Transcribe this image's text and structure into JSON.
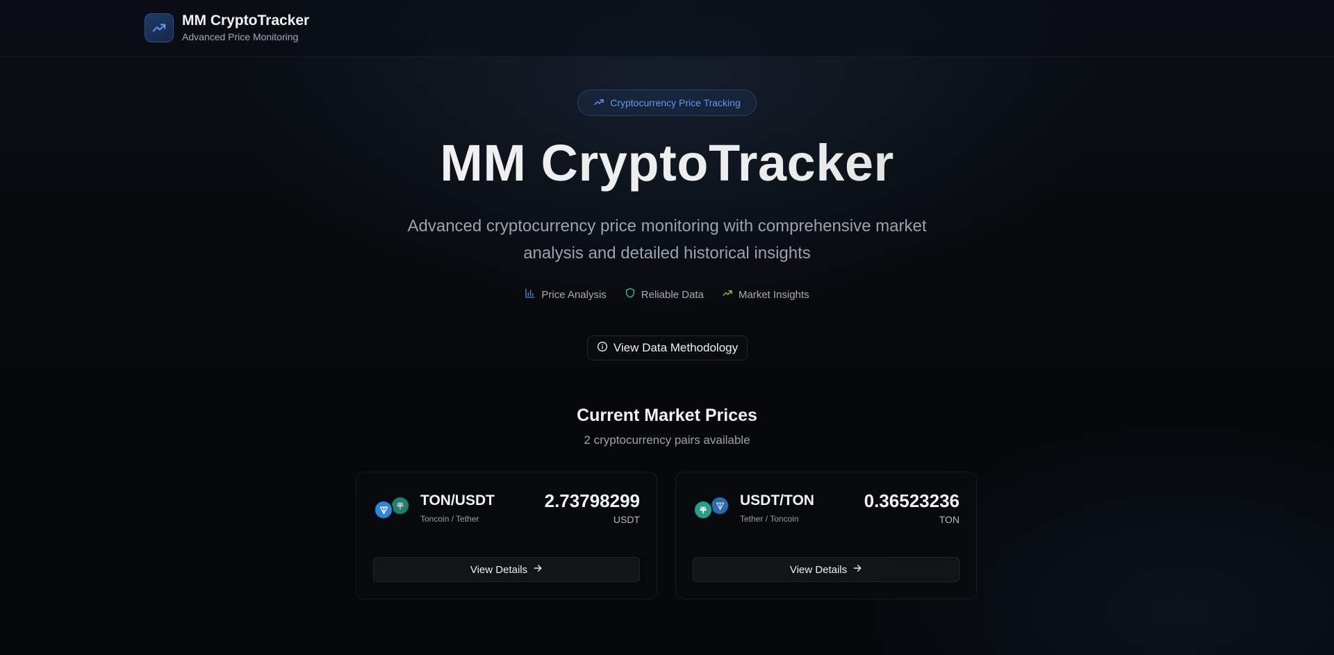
{
  "header": {
    "title": "MM CryptoTracker",
    "subtitle": "Advanced Price Monitoring",
    "logo_icon": "trending-up-icon"
  },
  "hero": {
    "badge": "Cryptocurrency Price Tracking",
    "title": "MM CryptoTracker",
    "subtitle": "Advanced cryptocurrency price monitoring with comprehensive market analysis and detailed historical insights",
    "features": [
      {
        "label": "Price Analysis",
        "icon": "bar-chart-icon",
        "color": "#4f86e8"
      },
      {
        "label": "Reliable Data",
        "icon": "shield-icon",
        "color": "#35c49a"
      },
      {
        "label": "Market Insights",
        "icon": "trending-up-icon",
        "color": "#9fc63a"
      }
    ],
    "methodology_button": "View Data Methodology"
  },
  "market": {
    "title": "Current Market Prices",
    "subtitle": "2 cryptocurrency pairs available",
    "pairs": [
      {
        "pair": "TON/USDT",
        "description": "Toncoin / Tether",
        "price": "2.73798299",
        "unit": "USDT",
        "button": "View Details",
        "primary_icon": "toncoin-icon",
        "secondary_icon": "tether-icon"
      },
      {
        "pair": "USDT/TON",
        "description": "Tether / Toncoin",
        "price": "0.36523236",
        "unit": "TON",
        "button": "View Details",
        "primary_icon": "tether-icon",
        "secondary_icon": "toncoin-icon"
      }
    ]
  },
  "colors": {
    "accent": "#5b9bf4",
    "background": "#07090c",
    "toncoin": "#2f86d6",
    "tether": "#2a9d86"
  }
}
